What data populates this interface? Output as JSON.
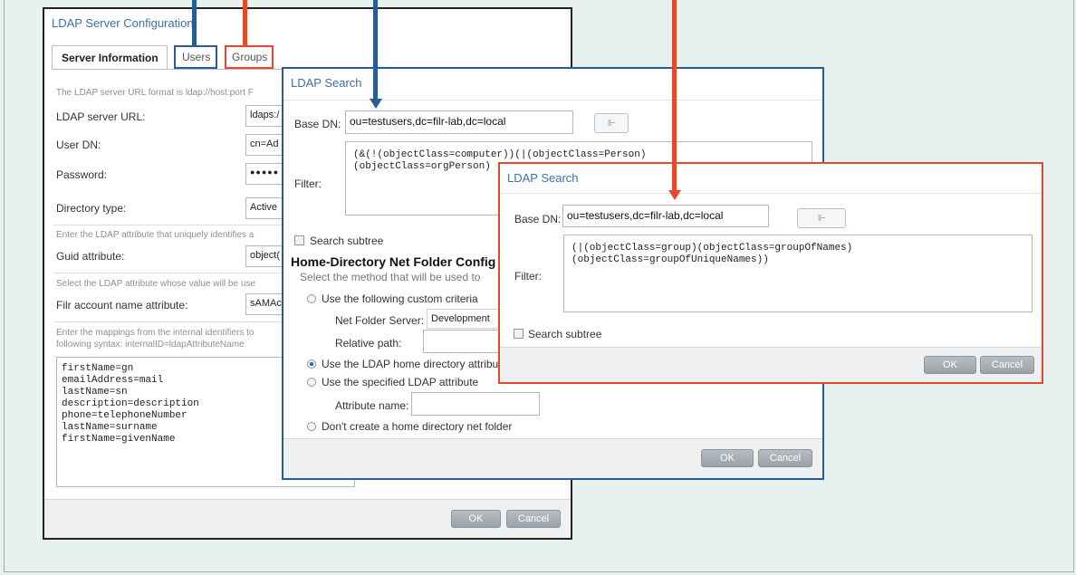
{
  "config_dialog": {
    "title": "LDAP Server Configuration",
    "tabs": [
      {
        "label": "Server Information"
      },
      {
        "label": "Users"
      },
      {
        "label": "Groups"
      }
    ],
    "url_hint": "The LDAP server URL format is ldap://host:port F",
    "url_label": "LDAP server URL:",
    "url_value": "ldaps:/",
    "userdn_label": "User DN:",
    "userdn_value": "cn=Ad",
    "password_label": "Password:",
    "password_value": "●●●●●",
    "dirtype_label": "Directory type:",
    "dirtype_value": "Active",
    "guid_hint": "Enter the LDAP attribute that uniquely identifies a",
    "guid_label": "Guid attribute:",
    "guid_value": "object(",
    "acct_hint": "Select the LDAP attribute whose value will be use",
    "acct_label": "Filr account name attribute:",
    "acct_value": "sAMAc",
    "map_hint_1": "Enter the mappings from the internal identifiers to",
    "map_hint_2": "following syntax: internalID=ldapAttributeName",
    "mappings": [
      "firstName=gn",
      "emailAddress=mail",
      "lastName=sn",
      "description=description",
      "phone=telephoneNumber",
      "lastName=surname",
      "firstName=givenName"
    ],
    "ok": "OK",
    "cancel": "Cancel"
  },
  "search_users": {
    "title": "LDAP Search",
    "basedn_label": "Base DN:",
    "basedn_value": "ou=testusers,dc=filr-lab,dc=local",
    "filter_label": "Filter:",
    "filter_line1": "(&(!(objectClass=computer))(|(objectClass=Person)",
    "filter_line2": "(objectClass=orgPerson)",
    "subtree_label": "Search subtree",
    "home_heading": "Home-Directory Net Folder Config",
    "home_sub": "Select the method that will be used to",
    "opt_custom": "Use the following custom criteria",
    "nfs_label": "Net Folder Server:",
    "nfs_value": "Development",
    "relpath_label": "Relative path:",
    "opt_home_attr": "Use the LDAP home directory attribut",
    "opt_specified": "Use the specified LDAP attribute",
    "attr_label": "Attribute name:",
    "opt_none": "Don't create a home directory net folder",
    "ok": "OK",
    "cancel": "Cancel"
  },
  "search_groups": {
    "title": "LDAP Search",
    "basedn_label": "Base DN:",
    "basedn_value": "ou=testusers,dc=filr-lab,dc=local",
    "filter_label": "Filter:",
    "filter_line1": "(|(objectClass=group)(objectClass=groupOfNames)",
    "filter_line2": "(objectClass=groupOfUniqueNames))",
    "subtree_label": "Search subtree",
    "ok": "OK",
    "cancel": "Cancel"
  },
  "colors": {
    "users_callout": "#2a5c94",
    "groups_callout": "#e34a2a",
    "title_text": "#3d6fa6"
  }
}
